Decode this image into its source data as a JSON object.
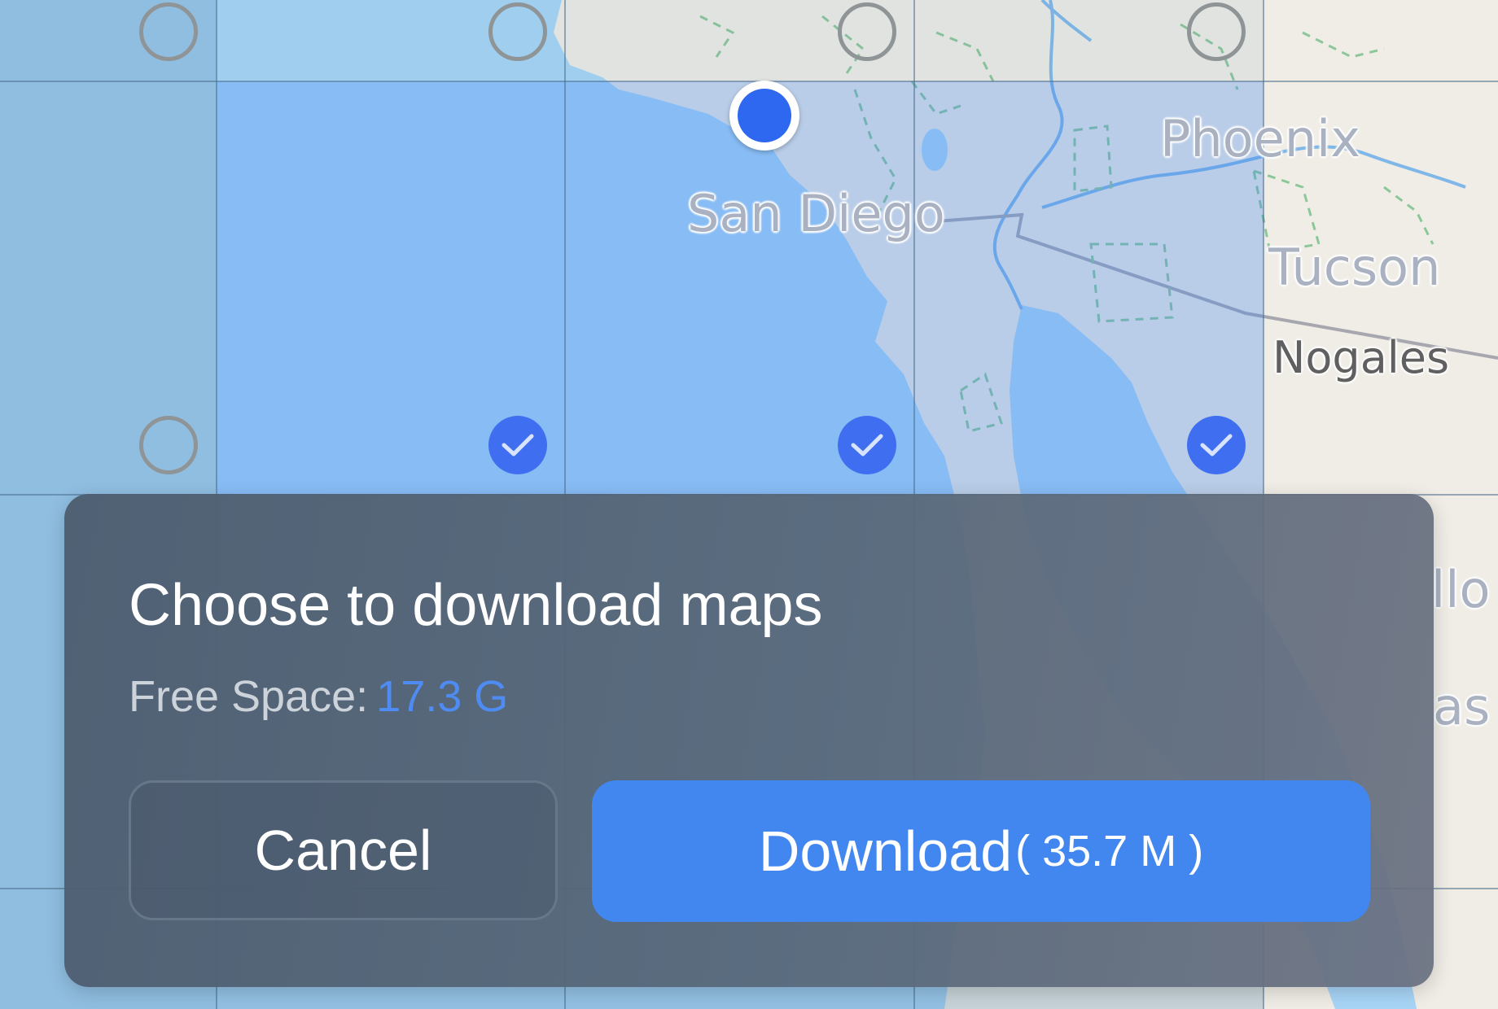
{
  "map": {
    "cities": {
      "phoenix": "Phoenix",
      "san_diego": "San Diego",
      "tucson": "Tucson",
      "nogales": "Nogales",
      "partial_right_1": "llo",
      "partial_right_2": "as"
    },
    "tiles": {
      "selected_count": 3,
      "unselected_visible_count": 5
    },
    "colors": {
      "selection_blue": "#3f6ff0",
      "location_dot": "#2e68f0",
      "ocean": "#96c6f2",
      "land": "#f0ede6"
    }
  },
  "dialog": {
    "title": "Choose to download maps",
    "free_space_label": "Free Space:",
    "free_space_value": "17.3 G",
    "cancel_label": "Cancel",
    "download_label": "Download",
    "download_size": "( 35.7 M )",
    "accent_color": "#4287f0"
  }
}
